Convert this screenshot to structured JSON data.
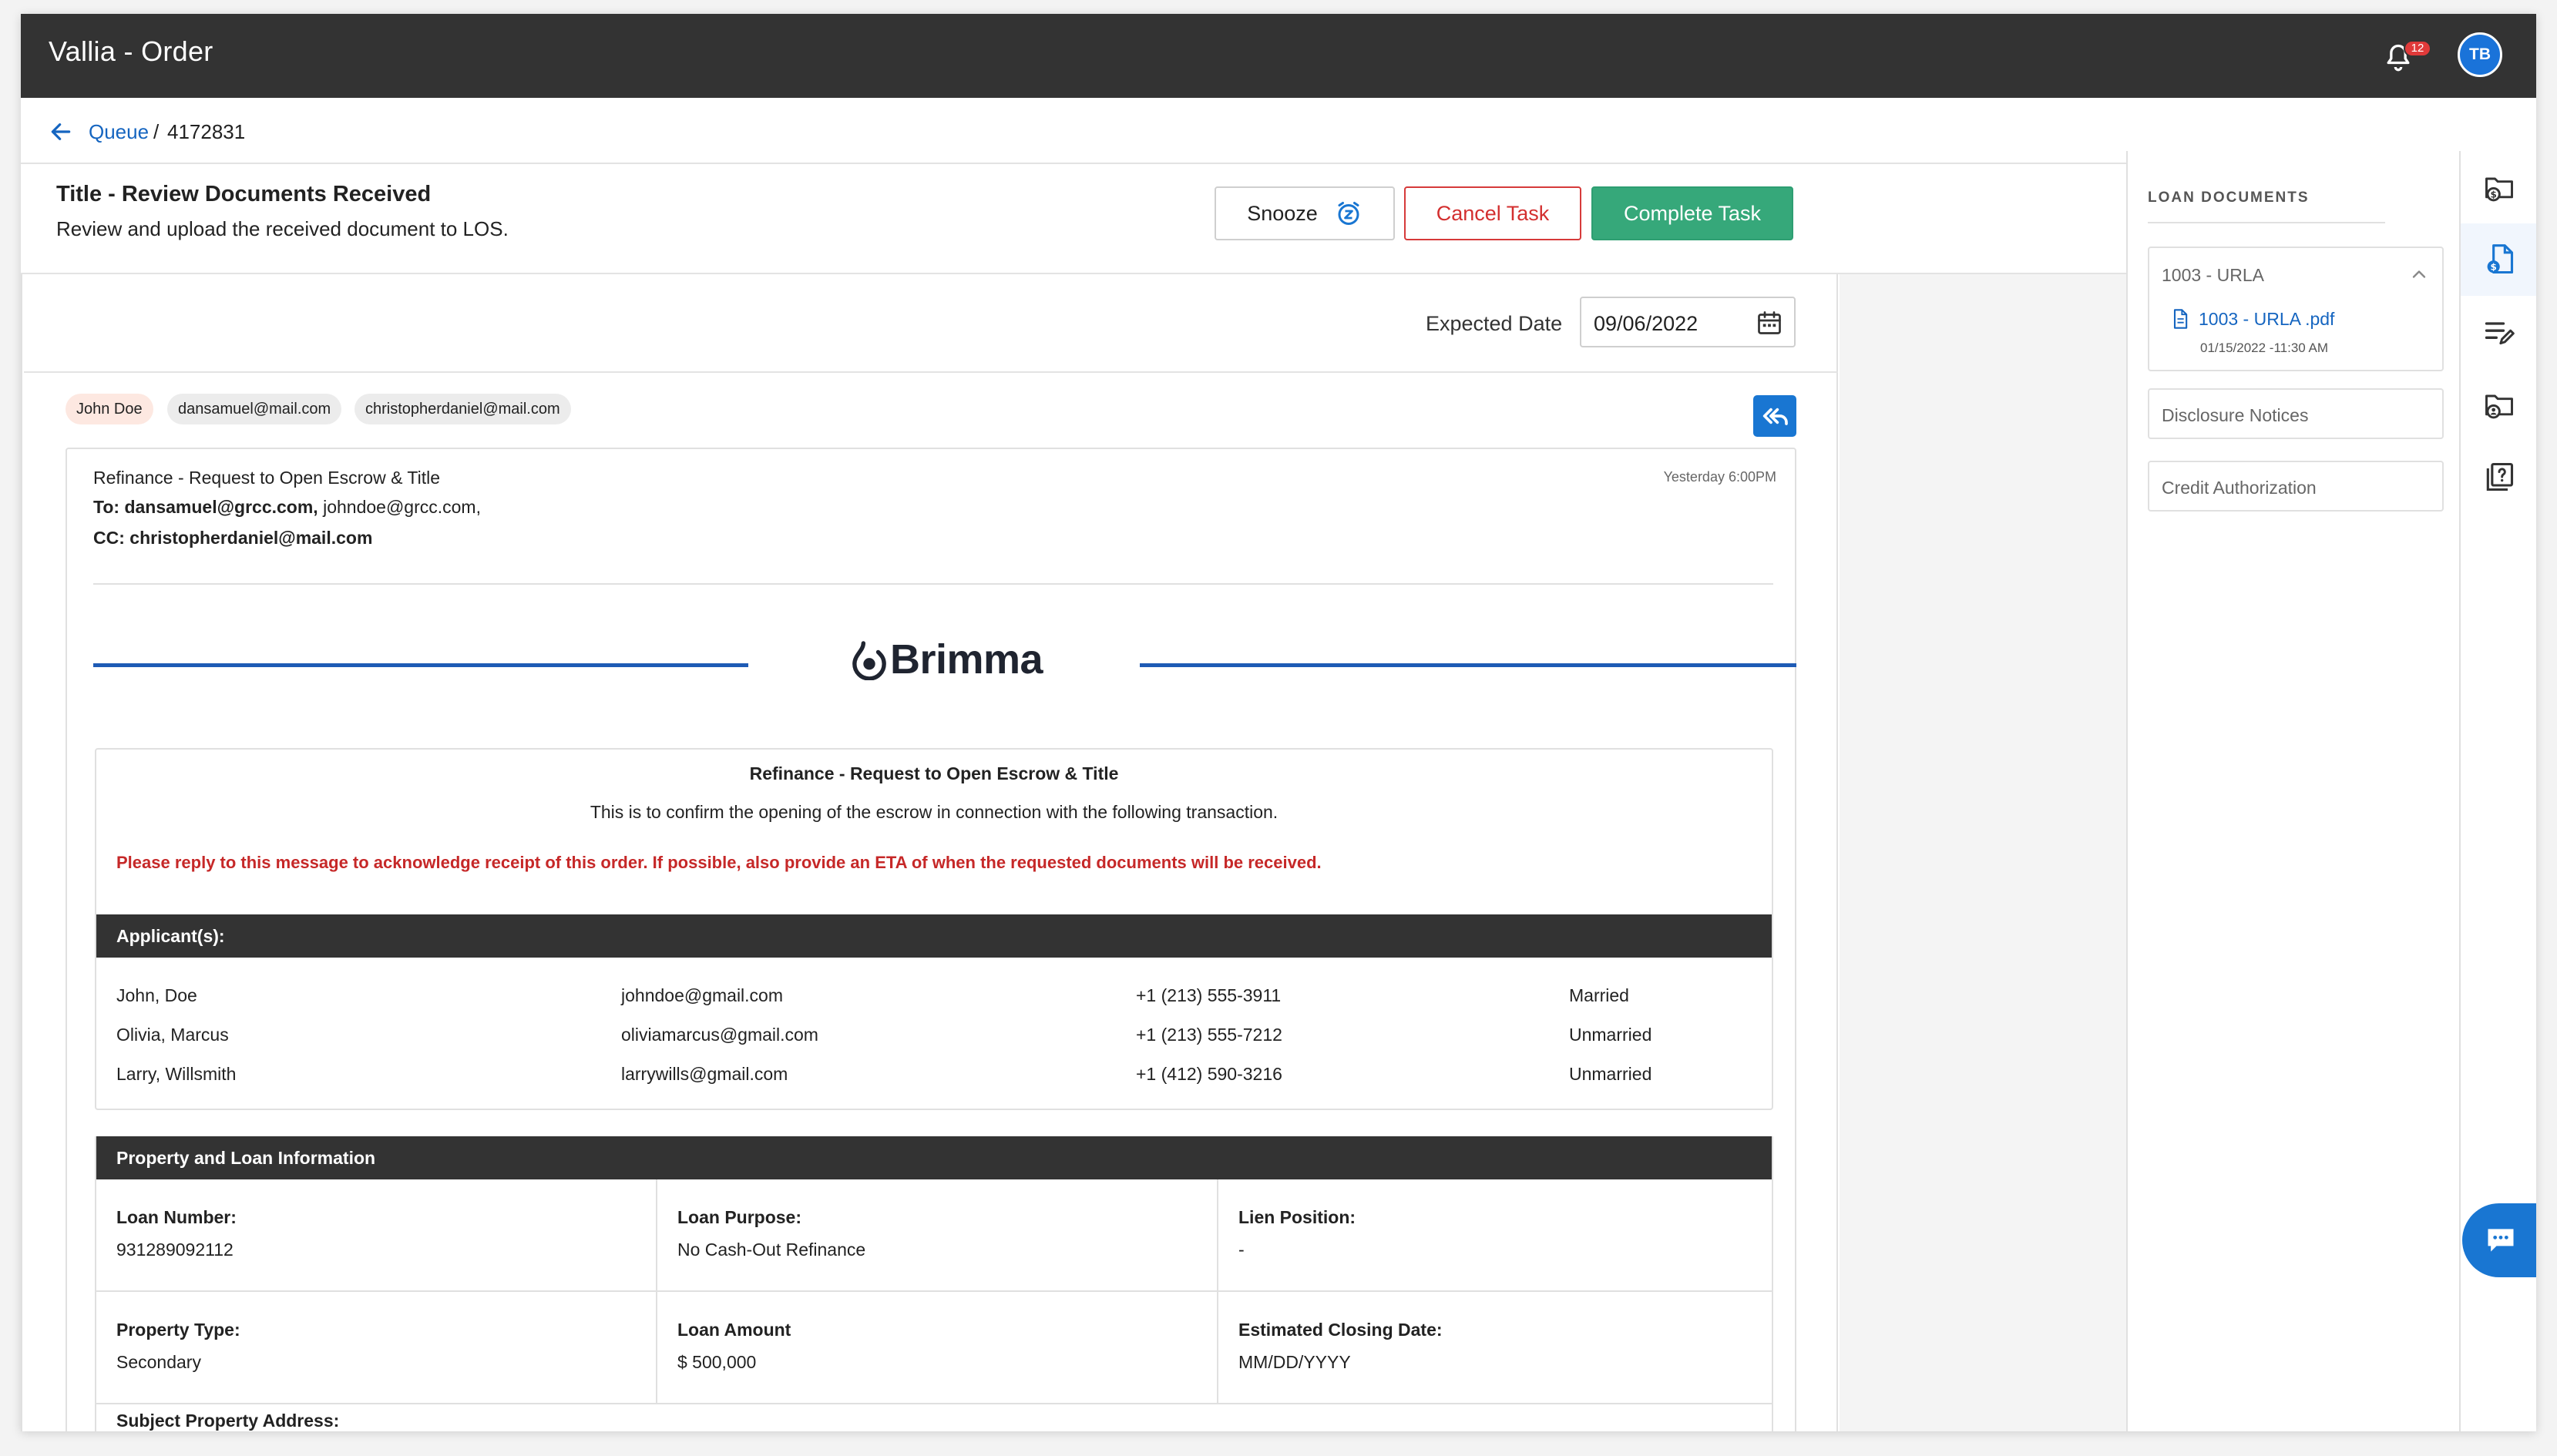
{
  "app": {
    "title": "Vallia - Order",
    "notification_count": "12",
    "user_initials": "TB",
    "accent_color": "#1976d2",
    "header_color": "#333333"
  },
  "breadcrumb": {
    "parent": "Queue",
    "separator": "/",
    "current": "4172831"
  },
  "task": {
    "title": "Title - Review Documents Received",
    "subtitle": "Review and upload the received document to LOS.",
    "snooze_label": "Snooze",
    "cancel_label": "Cancel Task",
    "complete_label": "Complete Task"
  },
  "expected": {
    "label": "Expected Date",
    "value": "09/06/2022"
  },
  "recipients": [
    "John Doe",
    "dansamuel@mail.com",
    "christopherdaniel@mail.com"
  ],
  "email": {
    "subject": "Refinance - Request to Open Escrow & Title",
    "to_label": "To:",
    "to_bold": "dansamuel@grcc.com,",
    "to_rest": "johndoe@grcc.com,",
    "cc_label": "CC:",
    "cc_value": "christopherdaniel@mail.com",
    "time": "Yesterday 6:00PM",
    "brand": "Brimma",
    "body_title": "Refinance - Request to Open Escrow & Title",
    "body_desc": "This is to confirm the opening of the escrow in connection with the following transaction.",
    "body_warning": "Please reply to this message to acknowledge receipt of this order. If possible, also provide an ETA of when the requested documents will be received.",
    "applicants_header": "Applicant(s):",
    "applicants": [
      {
        "name": "John, Doe",
        "email": "johndoe@gmail.com",
        "phone": "+1 (213) 555-3911",
        "status": "Married"
      },
      {
        "name": "Olivia, Marcus",
        "email": "oliviamarcus@gmail.com",
        "phone": "+1 (213) 555-7212",
        "status": "Unmarried"
      },
      {
        "name": "Larry, Willsmith",
        "email": "larrywills@gmail.com",
        "phone": "+1 (412) 590-3216",
        "status": "Unmarried"
      }
    ],
    "property_header": "Property and Loan Information",
    "property": [
      {
        "label": "Loan Number:",
        "value": "931289092112"
      },
      {
        "label": "Loan Purpose:",
        "value": "No Cash-Out Refinance"
      },
      {
        "label": "Lien Position:",
        "value": "-"
      },
      {
        "label": "Property Type:",
        "value": "Secondary"
      },
      {
        "label": "Loan Amount",
        "value": "$ 500,000"
      },
      {
        "label": "Estimated Closing Date:",
        "value": "MM/DD/YYYY"
      }
    ],
    "next_label": "Subject Property Address:"
  },
  "loan_documents": {
    "title": "LOAN DOCUMENTS",
    "groups": [
      {
        "name": "1003 - URLA",
        "file": "1003 - URLA .pdf",
        "file_time": "01/15/2022 -11:30 AM"
      },
      {
        "name": "Disclosure Notices"
      },
      {
        "name": "Credit Authorization"
      }
    ]
  }
}
